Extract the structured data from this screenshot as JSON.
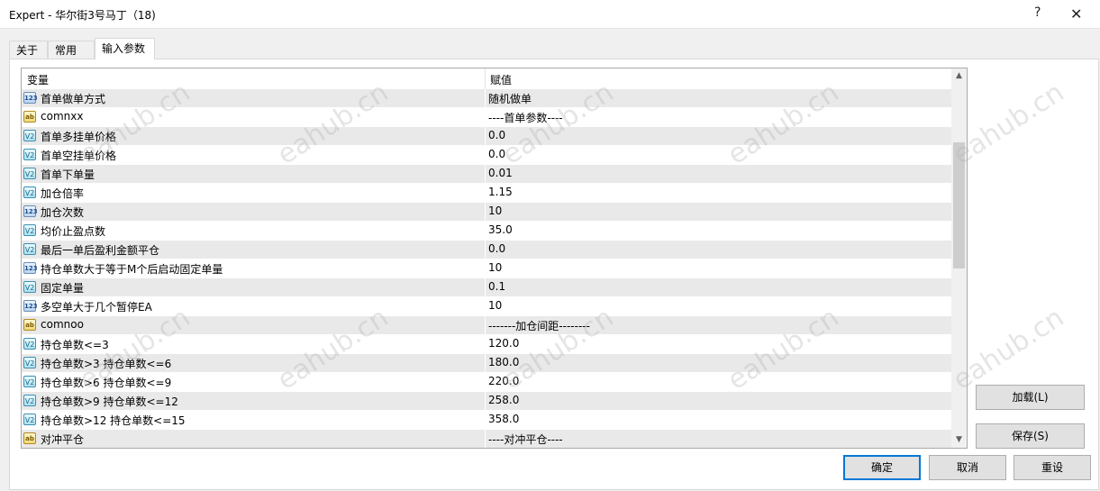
{
  "window": {
    "title": "Expert - 华尔街3号马丁（18)",
    "help_glyph": "?",
    "close_glyph": "✕"
  },
  "tabs": [
    {
      "label": "关于"
    },
    {
      "label": "常用"
    },
    {
      "label": "输入参数",
      "active": true
    }
  ],
  "grid": {
    "headers": {
      "variable": "变量",
      "value": "赋值"
    },
    "rows": [
      {
        "type": "int",
        "icon": "123",
        "name": "首单做单方式",
        "value": "随机做单"
      },
      {
        "type": "str",
        "icon": "ab",
        "name": "comnxx",
        "value": "----首单参数----"
      },
      {
        "type": "dbl",
        "icon": "V2",
        "name": "首单多挂单价格",
        "value": "0.0"
      },
      {
        "type": "dbl",
        "icon": "V2",
        "name": "首单空挂单价格",
        "value": "0.0"
      },
      {
        "type": "dbl",
        "icon": "V2",
        "name": "首单下单量",
        "value": "0.01"
      },
      {
        "type": "dbl",
        "icon": "V2",
        "name": "加仓倍率",
        "value": "1.15"
      },
      {
        "type": "int",
        "icon": "123",
        "name": "加仓次数",
        "value": "10"
      },
      {
        "type": "dbl",
        "icon": "V2",
        "name": "均价止盈点数",
        "value": "35.0"
      },
      {
        "type": "dbl",
        "icon": "V2",
        "name": "最后一单后盈利金额平仓",
        "value": "0.0"
      },
      {
        "type": "int",
        "icon": "123",
        "name": "持仓单数大于等于M个后启动固定单量",
        "value": "10"
      },
      {
        "type": "dbl",
        "icon": "V2",
        "name": "固定单量",
        "value": "0.1"
      },
      {
        "type": "int",
        "icon": "123",
        "name": "多空单大于几个暂停EA",
        "value": "10"
      },
      {
        "type": "str",
        "icon": "ab",
        "name": "comnoo",
        "value": "-------加仓间距--------"
      },
      {
        "type": "dbl",
        "icon": "V2",
        "name": "持仓单数<=3",
        "value": "120.0"
      },
      {
        "type": "dbl",
        "icon": "V2",
        "name": "持仓单数>3   持仓单数<=6",
        "value": "180.0"
      },
      {
        "type": "dbl",
        "icon": "V2",
        "name": "持仓单数>6   持仓单数<=9",
        "value": "220.0"
      },
      {
        "type": "dbl",
        "icon": "V2",
        "name": "持仓单数>9   持仓单数<=12",
        "value": "258.0"
      },
      {
        "type": "dbl",
        "icon": "V2",
        "name": "持仓单数>12  持仓单数<=15",
        "value": "358.0"
      },
      {
        "type": "str",
        "icon": "ab",
        "name": "对冲平仓",
        "value": "----对冲平仓----"
      }
    ]
  },
  "scrollbar": {
    "up_glyph": "▲",
    "down_glyph": "▼"
  },
  "buttons": {
    "load": "加载(L)",
    "save": "保存(S)",
    "ok": "确定",
    "cancel": "取消",
    "reset": "重设"
  },
  "watermark": {
    "text": "eahub.cn"
  }
}
